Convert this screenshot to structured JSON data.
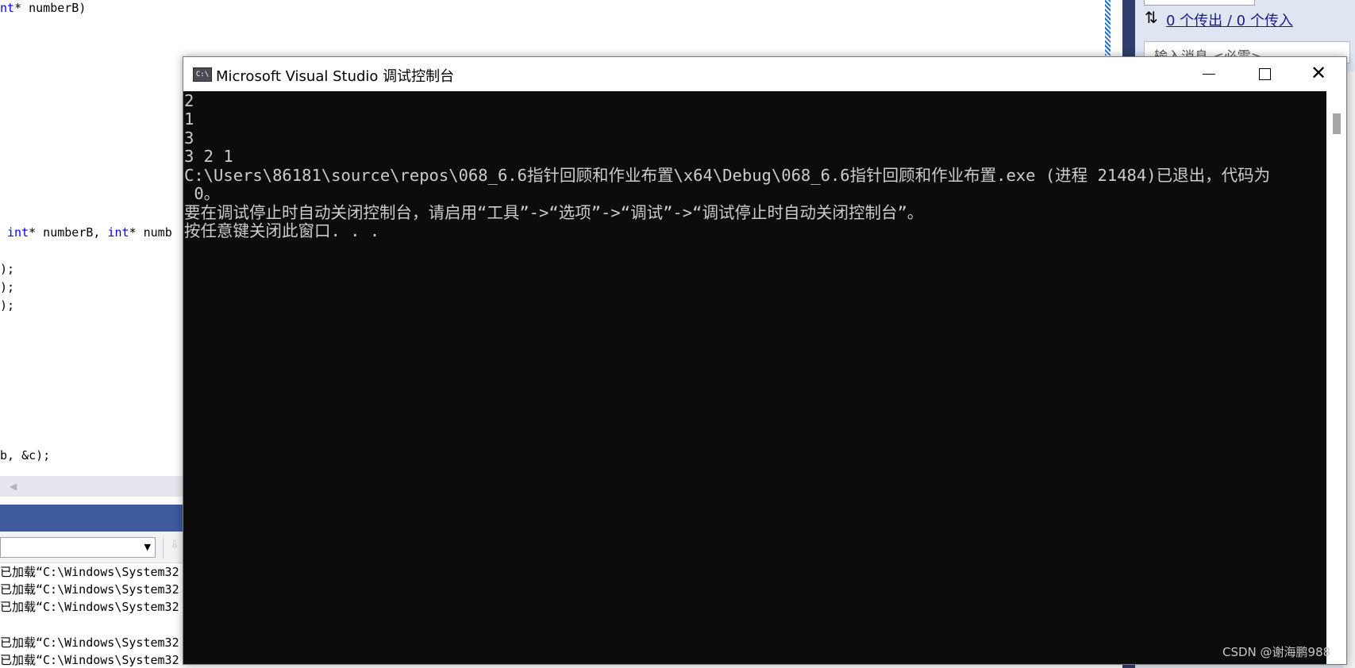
{
  "editor": {
    "code_lines": [
      {
        "pre": "",
        "kw": "nt",
        "post": "* numberB)"
      },
      {
        "pre": " ",
        "kw": "int",
        "post": "* numberB, "
      },
      {
        "pre": "",
        "kw": "",
        "post": ");"
      },
      {
        "pre": "",
        "kw": "",
        "post": ");"
      },
      {
        "pre": "",
        "kw": "",
        "post": ");"
      },
      {
        "pre": "",
        "kw": "",
        "post": "b, &c);"
      }
    ],
    "code_line2_kw2": "int",
    "code_line2_tail": "* numb"
  },
  "output_pane": {
    "lines": [
      "已加载“C:\\Windows\\System32",
      "已加载“C:\\Windows\\System32",
      "已加载“C:\\Windows\\System32",
      "已加载“C:\\Windows\\System32",
      "已加载“C:\\Windows\\System32"
    ]
  },
  "right_panel": {
    "transfer_label": "0 个传出 / 0 个传入",
    "message_placeholder": "输入消息 <必需>"
  },
  "console": {
    "title": "Microsoft Visual Studio 调试控制台",
    "icon_text": "C:\\",
    "lines": [
      "2",
      "1",
      "3",
      "3 2 1",
      "C:\\Users\\86181\\source\\repos\\068_6.6指针回顾和作业布置\\x64\\Debug\\068_6.6指针回顾和作业布置.exe (进程 21484)已退出，代码为",
      " 0。",
      "要在调试停止时自动关闭控制台，请启用“工具”->“选项”->“调试”->“调试停止时自动关闭控制台”。",
      "按任意键关闭此窗口. . ."
    ]
  },
  "watermark": "CSDN @谢海鹏988"
}
